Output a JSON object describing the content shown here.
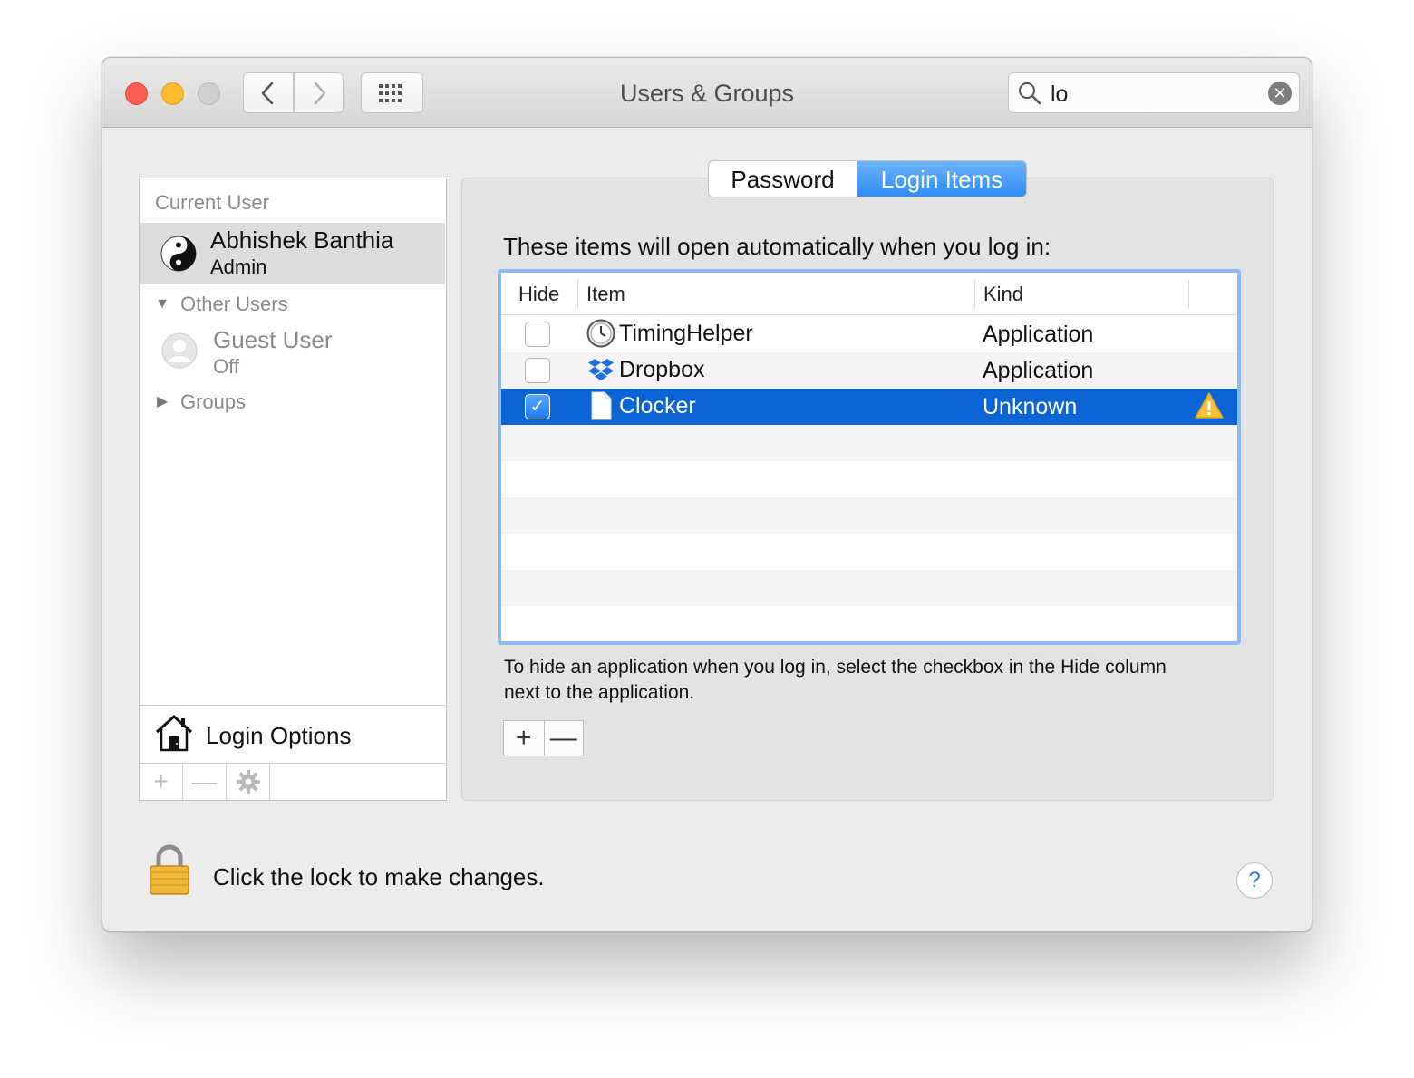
{
  "window": {
    "title": "Users & Groups"
  },
  "search": {
    "value": "lo"
  },
  "sidebar": {
    "current_user_header": "Current User",
    "current_user": {
      "name": "Abhishek Banthia",
      "role": "Admin"
    },
    "other_users_header": "Other Users",
    "guest_user": {
      "name": "Guest User",
      "status": "Off"
    },
    "groups_label": "Groups",
    "login_options_label": "Login Options",
    "toolbar": {
      "add": "+",
      "remove": "—"
    }
  },
  "tabs": [
    {
      "label": "Password",
      "selected": false
    },
    {
      "label": "Login Items",
      "selected": true
    }
  ],
  "login_items": {
    "intro": "These items will open automatically when you log in:",
    "columns": [
      "Hide",
      "Item",
      "Kind"
    ],
    "rows": [
      {
        "hide": false,
        "name": "TimingHelper",
        "kind": "Application",
        "icon": "clock-icon"
      },
      {
        "hide": false,
        "name": "Dropbox",
        "kind": "Application",
        "icon": "dropbox-icon"
      },
      {
        "hide": true,
        "name": "Clocker",
        "kind": "Unknown",
        "icon": "document-icon",
        "warning": true,
        "selected": true
      }
    ],
    "help_text": "To hide an application when you log in, select the checkbox in the Hide column next to the application.",
    "add_label": "+",
    "remove_label": "—"
  },
  "footer": {
    "lock_text": "Click the lock to make changes.",
    "help_label": "?"
  },
  "colors": {
    "selection": "#0a64d6",
    "tab_selected": "#2f8cf7",
    "focus_ring": "#8cbaf1"
  }
}
